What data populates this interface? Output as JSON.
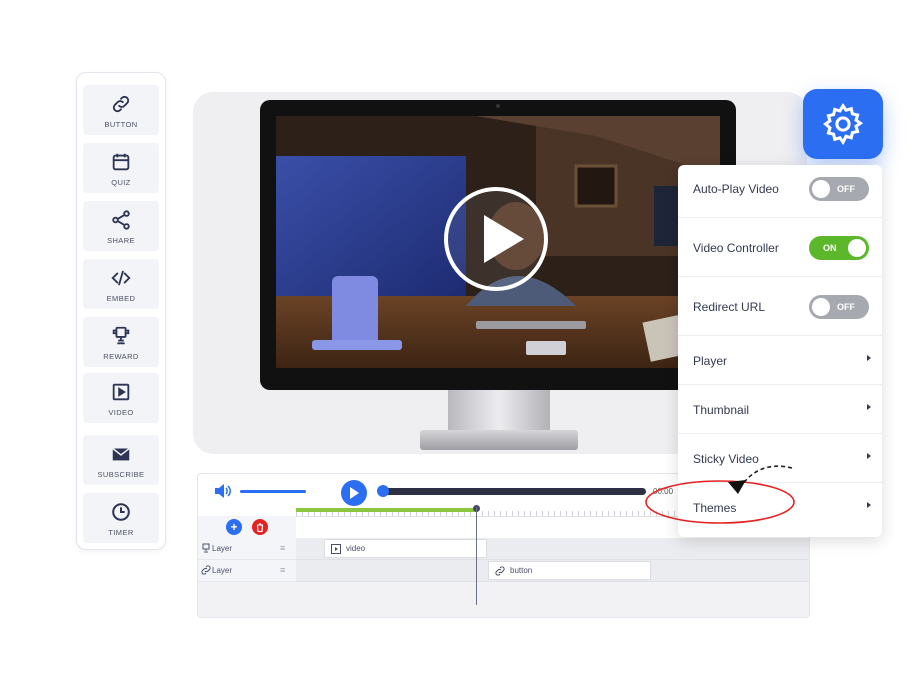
{
  "toolbox": {
    "items": [
      {
        "label": "BUTTON",
        "icon": "link-icon"
      },
      {
        "label": "QUIZ",
        "icon": "calendar-icon"
      },
      {
        "label": "SHARE",
        "icon": "share-icon"
      },
      {
        "label": "EMBED",
        "icon": "code-icon"
      },
      {
        "label": "REWARD",
        "icon": "trophy-icon"
      },
      {
        "label": "VIDEO",
        "icon": "video-icon"
      },
      {
        "label": "SUBSCRIBE",
        "icon": "mail-icon"
      },
      {
        "label": "TIMER",
        "icon": "clock-icon"
      }
    ]
  },
  "player": {
    "time": "00:00"
  },
  "timeline": {
    "layers": [
      {
        "label": "Layer",
        "clip": "video"
      },
      {
        "label": "Layer",
        "clip": "button"
      }
    ]
  },
  "settings": {
    "autoplay": {
      "label": "Auto-Play Video",
      "state": "OFF"
    },
    "controller": {
      "label": "Video Controller",
      "state": "ON"
    },
    "redirect": {
      "label": "Redirect URL",
      "state": "OFF"
    },
    "player": "Player",
    "thumbnail": "Thumbnail",
    "sticky": "Sticky Video",
    "themes": "Themes"
  },
  "colors": {
    "accent": "#2b6ef2",
    "on": "#5cb82a",
    "off": "#a7a9b0",
    "annotation": "#e52222"
  }
}
